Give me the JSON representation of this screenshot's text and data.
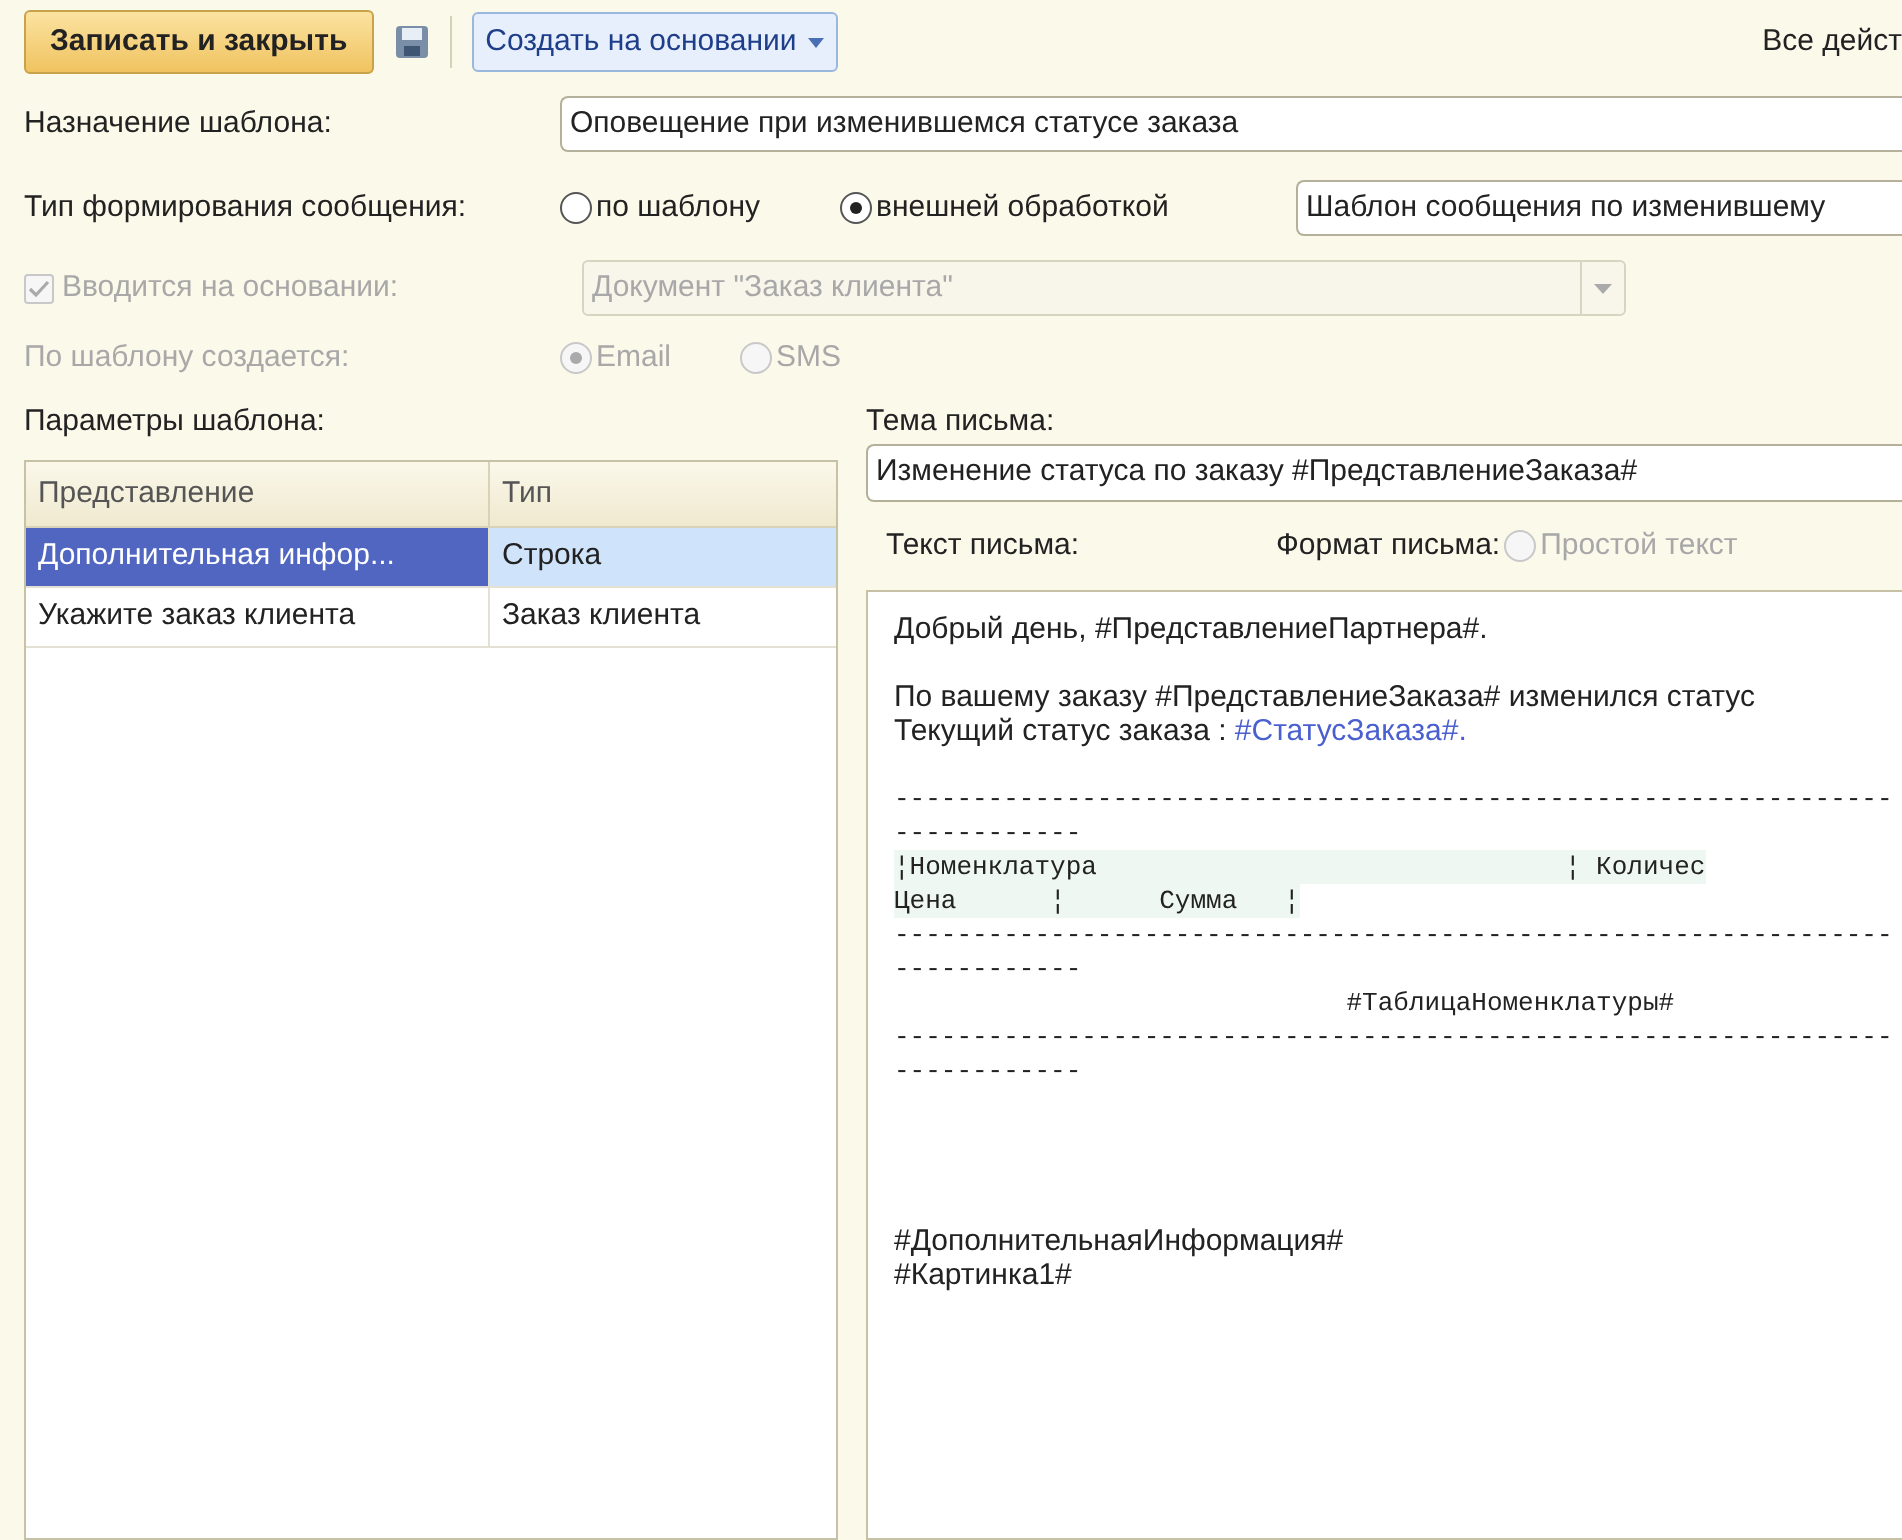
{
  "toolbar": {
    "primary_button": "Записать и закрыть",
    "create_based_button": "Создать на основании",
    "all_actions": "Все дейст"
  },
  "purpose": {
    "label": "Назначение шаблона:",
    "value": "Оповещение при изменившемся статусе заказа"
  },
  "generation": {
    "label": "Тип формирования сообщения:",
    "options": [
      {
        "label": "по шаблону",
        "selected": false
      },
      {
        "label": "внешней обработкой",
        "selected": true
      }
    ],
    "value": "Шаблон сообщения по изменившему"
  },
  "based_on": {
    "label": "Вводится на основании:",
    "checked": true,
    "disabled": true,
    "value": "Документ \"Заказ клиента\""
  },
  "created_by": {
    "label": "По шаблону создается:",
    "disabled": true,
    "options": [
      {
        "label": "Email",
        "selected": true
      },
      {
        "label": "SMS",
        "selected": false
      }
    ]
  },
  "params": {
    "label": "Параметры шаблона:",
    "columns": [
      "Представление",
      "Тип"
    ],
    "rows": [
      {
        "cells": [
          "Дополнительная инфор...",
          "Строка"
        ],
        "selected": true
      },
      {
        "cells": [
          "Укажите заказ клиента",
          "Заказ клиента"
        ],
        "selected": false
      }
    ]
  },
  "subject": {
    "label": "Тема письма:",
    "value": "Изменение статуса по заказу #ПредставлениеЗаказа#"
  },
  "body": {
    "label": "Текст письма:",
    "format_label": "Формат письма:",
    "format_options": [
      {
        "label": "Простой текст",
        "selected": false,
        "disabled": true
      }
    ],
    "lines": [
      {
        "kind": "text",
        "text": "Добрый день, #ПредставлениеПартнера#."
      },
      {
        "kind": "blank"
      },
      {
        "kind": "text",
        "text": "По вашему заказу #ПредставлениеЗаказа# изменился статус"
      },
      {
        "kind": "text",
        "text": "Текущий статус заказа : ",
        "link": "#СтатусЗаказа#."
      },
      {
        "kind": "blank"
      },
      {
        "kind": "mono",
        "text": "----------------------------------------------------------------"
      },
      {
        "kind": "mono",
        "text": "------------"
      },
      {
        "kind": "mono_header",
        "text": "¦Номенклатура                              ¦ Количес"
      },
      {
        "kind": "mono_header",
        "text": "Цена      ¦      Сумма   ¦"
      },
      {
        "kind": "mono",
        "text": "----------------------------------------------------------------"
      },
      {
        "kind": "mono",
        "text": "------------"
      },
      {
        "kind": "mono",
        "text": "                             #ТаблицаНоменклатуры#"
      },
      {
        "kind": "mono",
        "text": "----------------------------------------------------------------"
      },
      {
        "kind": "mono",
        "text": "------------"
      },
      {
        "kind": "blank"
      },
      {
        "kind": "blank"
      },
      {
        "kind": "blank"
      },
      {
        "kind": "blank"
      },
      {
        "kind": "text",
        "text": "#ДополнительнаяИнформация#"
      },
      {
        "kind": "text",
        "text": "#Картинка1#"
      }
    ]
  }
}
